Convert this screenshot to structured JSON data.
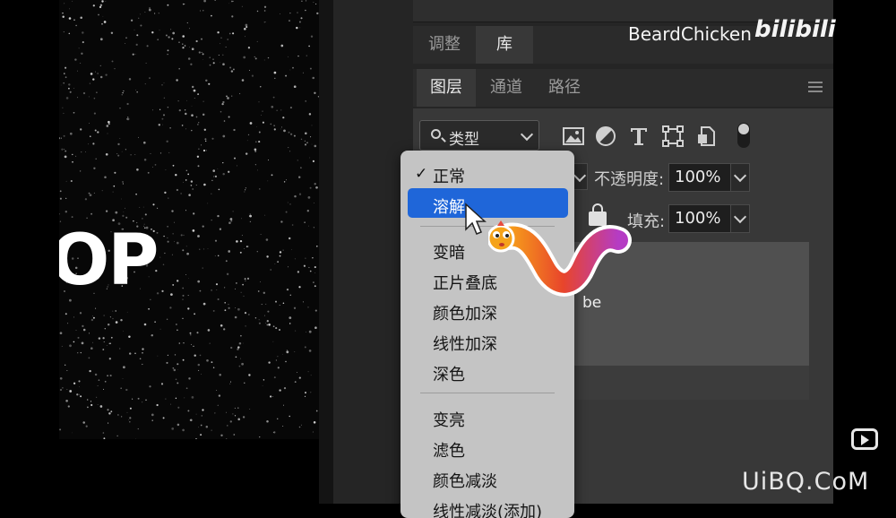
{
  "canvas": {
    "partial_text": "OP"
  },
  "panel": {
    "tabs_top": [
      {
        "label": "调整",
        "active": false
      },
      {
        "label": "库",
        "active": true
      }
    ],
    "tabs_main": [
      {
        "label": "图层",
        "active": true
      },
      {
        "label": "通道",
        "active": false
      },
      {
        "label": "路径",
        "active": false
      }
    ],
    "filter": {
      "label": "类型"
    },
    "filter_icons": [
      "image-filter-icon",
      "adjustment-filter-icon",
      "type-filter-icon",
      "shape-filter-icon",
      "smart-object-filter-icon",
      "filter-toggle"
    ],
    "opacity": {
      "label": "不透明度:",
      "value": "100%"
    },
    "fill": {
      "label": "填充:",
      "value": "100%"
    },
    "layer": {
      "name_fragment": "be"
    }
  },
  "dropdown": {
    "checked_item": "正常",
    "highlighted_item": "溶解",
    "items": [
      "正常",
      "溶解",
      "变暗",
      "正片叠底",
      "颜色加深",
      "线性加深",
      "深色",
      "变亮",
      "滤色",
      "颜色减淡",
      "线性减淡(添加)"
    ]
  },
  "overlay": {
    "watermark": "BeardChicken",
    "platform_logo": "bilibili",
    "site_mark": "UiBQ.CoM"
  },
  "colors": {
    "panel_bg": "#252525",
    "highlight": "#1f66d9",
    "dropdown_bg": "#c4c4c4"
  }
}
